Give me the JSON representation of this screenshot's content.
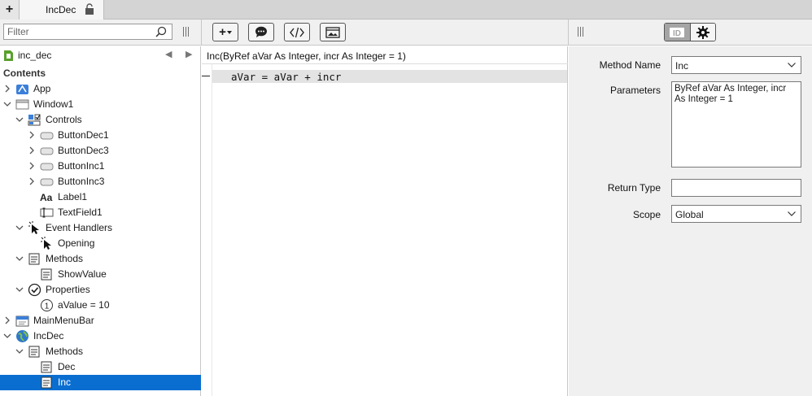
{
  "tabs": {
    "add_label": "+",
    "items": [
      {
        "label": "IncDec",
        "locked": true
      }
    ]
  },
  "toolbar": {
    "filter_placeholder": "Filter",
    "add_button_label": "+",
    "buttons": [
      "add-menu",
      "comment",
      "code",
      "layout"
    ],
    "inspector_segments": [
      "id",
      "settings"
    ]
  },
  "navigator": {
    "project": "inc_dec",
    "contents_label": "Contents",
    "selected": "Inc",
    "tree": [
      {
        "label": "App",
        "icon": "app-icon",
        "level": 0,
        "chevron": "right"
      },
      {
        "label": "Window1",
        "icon": "window-icon",
        "level": 0,
        "chevron": "down"
      },
      {
        "label": "Controls",
        "icon": "controls-icon",
        "level": 1,
        "chevron": "down"
      },
      {
        "label": "ButtonDec1",
        "icon": "button-control-icon",
        "level": 2,
        "chevron": "right"
      },
      {
        "label": "ButtonDec3",
        "icon": "button-control-icon",
        "level": 2,
        "chevron": "right"
      },
      {
        "label": "ButtonInc1",
        "icon": "button-control-icon",
        "level": 2,
        "chevron": "right"
      },
      {
        "label": "ButtonInc3",
        "icon": "button-control-icon",
        "level": 2,
        "chevron": "right"
      },
      {
        "label": "Label1",
        "icon": "label-control-icon",
        "level": 2,
        "chevron": ""
      },
      {
        "label": "TextField1",
        "icon": "textfield-control-icon",
        "level": 2,
        "chevron": ""
      },
      {
        "label": "Event Handlers",
        "icon": "event-handlers-icon",
        "level": 1,
        "chevron": "down"
      },
      {
        "label": "Opening",
        "icon": "event-icon",
        "level": 2,
        "chevron": ""
      },
      {
        "label": "Methods",
        "icon": "methods-icon",
        "level": 1,
        "chevron": "down"
      },
      {
        "label": "ShowValue",
        "icon": "method-icon",
        "level": 2,
        "chevron": ""
      },
      {
        "label": "Properties",
        "icon": "properties-icon",
        "level": 1,
        "chevron": "down"
      },
      {
        "label": "aValue = 10",
        "icon": "property-icon",
        "level": 2,
        "chevron": ""
      },
      {
        "label": "MainMenuBar",
        "icon": "menubar-icon",
        "level": 0,
        "chevron": "right"
      },
      {
        "label": "IncDec",
        "icon": "module-icon",
        "level": 0,
        "chevron": "down"
      },
      {
        "label": "Methods",
        "icon": "methods-icon",
        "level": 1,
        "chevron": "down"
      },
      {
        "label": "Dec",
        "icon": "method-icon",
        "level": 2,
        "chevron": ""
      },
      {
        "label": "Inc",
        "icon": "method-icon",
        "level": 2,
        "chevron": ""
      }
    ]
  },
  "editor": {
    "signature": "Inc(ByRef aVar As Integer, incr As Integer = 1)",
    "code_lines": [
      "aVar = aVar + incr"
    ]
  },
  "inspector": {
    "method_name_label": "Method Name",
    "method_name_value": "Inc",
    "parameters_label": "Parameters",
    "parameters_value": "ByRef aVar As Integer, incr As Integer = 1",
    "return_type_label": "Return Type",
    "return_type_value": "",
    "scope_label": "Scope",
    "scope_value": "Global"
  },
  "colors": {
    "selection": "#0a6ed1",
    "panel_bg": "#f0f0f0",
    "tabstrip_bg": "#d4d4d4"
  }
}
